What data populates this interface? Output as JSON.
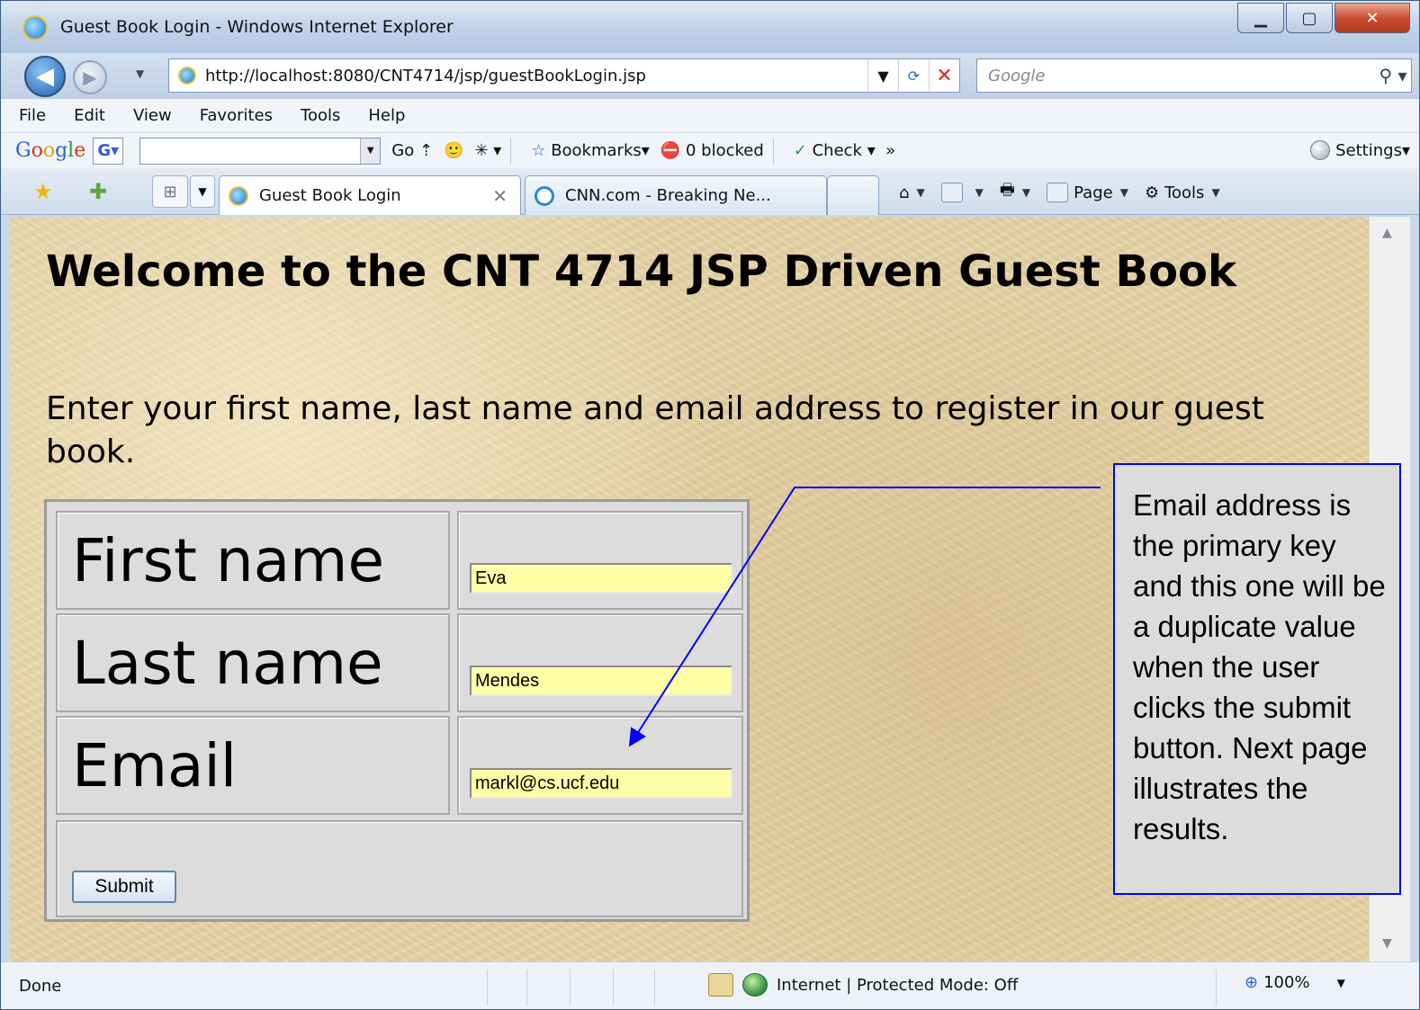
{
  "window": {
    "title": "Guest Book Login - Windows Internet Explorer"
  },
  "nav": {
    "url": "http://localhost:8080/CNT4714/jsp/guestBookLogin.jsp",
    "search_placeholder": "Google"
  },
  "menu": [
    "File",
    "Edit",
    "View",
    "Favorites",
    "Tools",
    "Help"
  ],
  "gtoolbar": {
    "go": "Go",
    "bookmarks": "Bookmarks",
    "blocked": "0 blocked",
    "check": "Check",
    "more": "»",
    "settings": "Settings"
  },
  "tabs": [
    {
      "label": "Guest Book Login",
      "active": true
    },
    {
      "label": "CNN.com - Breaking Ne...",
      "active": false
    }
  ],
  "cmdbar": {
    "page": "Page",
    "tools": "Tools"
  },
  "page": {
    "heading": "Welcome to the CNT 4714 JSP Driven Guest Book",
    "intro": "Enter your first name, last name and email address to register in our guest book.",
    "form": {
      "first_label": "First name",
      "first_value": "Eva",
      "last_label": "Last name",
      "last_value": "Mendes",
      "email_label": "Email",
      "email_value": "markl@cs.ucf.edu",
      "submit": "Submit"
    }
  },
  "callout": {
    "text": "Email address is the primary key and this one will be a duplicate value when the user clicks the submit button. Next page illustrates the results.",
    "color": "#0000ff"
  },
  "status": {
    "text": "Done",
    "zone": "Internet | Protected Mode: Off",
    "zoom": "100%"
  }
}
